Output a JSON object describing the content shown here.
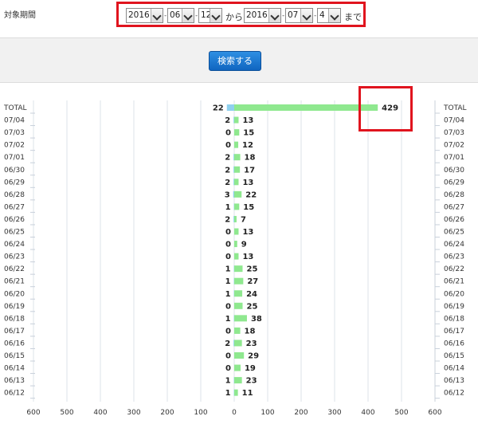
{
  "period": {
    "label": "対象期間",
    "from": {
      "year": "2016",
      "month": "06",
      "day": "12"
    },
    "from_text": "から",
    "to": {
      "year": "2016",
      "month": "07",
      "day": "4"
    },
    "to_text": "まで",
    "separator": "-"
  },
  "search_button_label": "検索する",
  "colors": {
    "bar_positive": "#8fe88f",
    "bar_negative": "#8fd0ee",
    "highlight": "#e0141e",
    "button": "#1a7ad6"
  },
  "chart_data": {
    "type": "bar",
    "orientation": "horizontal-diverging",
    "categories": [
      "TOTAL",
      "07/04",
      "07/03",
      "07/02",
      "07/01",
      "06/30",
      "06/29",
      "06/28",
      "06/27",
      "06/26",
      "06/25",
      "06/24",
      "06/23",
      "06/22",
      "06/21",
      "06/20",
      "06/19",
      "06/18",
      "06/17",
      "06/16",
      "06/15",
      "06/14",
      "06/13",
      "06/12"
    ],
    "series": [
      {
        "values": [
          22,
          2,
          0,
          0,
          2,
          2,
          2,
          3,
          1,
          2,
          0,
          0,
          0,
          1,
          1,
          1,
          0,
          1,
          0,
          2,
          0,
          0,
          1,
          1
        ]
      },
      {
        "values": [
          429,
          13,
          15,
          12,
          18,
          17,
          13,
          22,
          15,
          7,
          13,
          9,
          13,
          25,
          27,
          24,
          25,
          38,
          18,
          23,
          29,
          19,
          23,
          11
        ]
      }
    ],
    "x_ticks_left": [
      "600",
      "500",
      "400",
      "300",
      "200",
      "100",
      "0"
    ],
    "x_ticks_right": [
      "0",
      "100",
      "200",
      "300",
      "400",
      "500",
      "600"
    ],
    "xlim": [
      -600,
      600
    ],
    "grid": true
  }
}
